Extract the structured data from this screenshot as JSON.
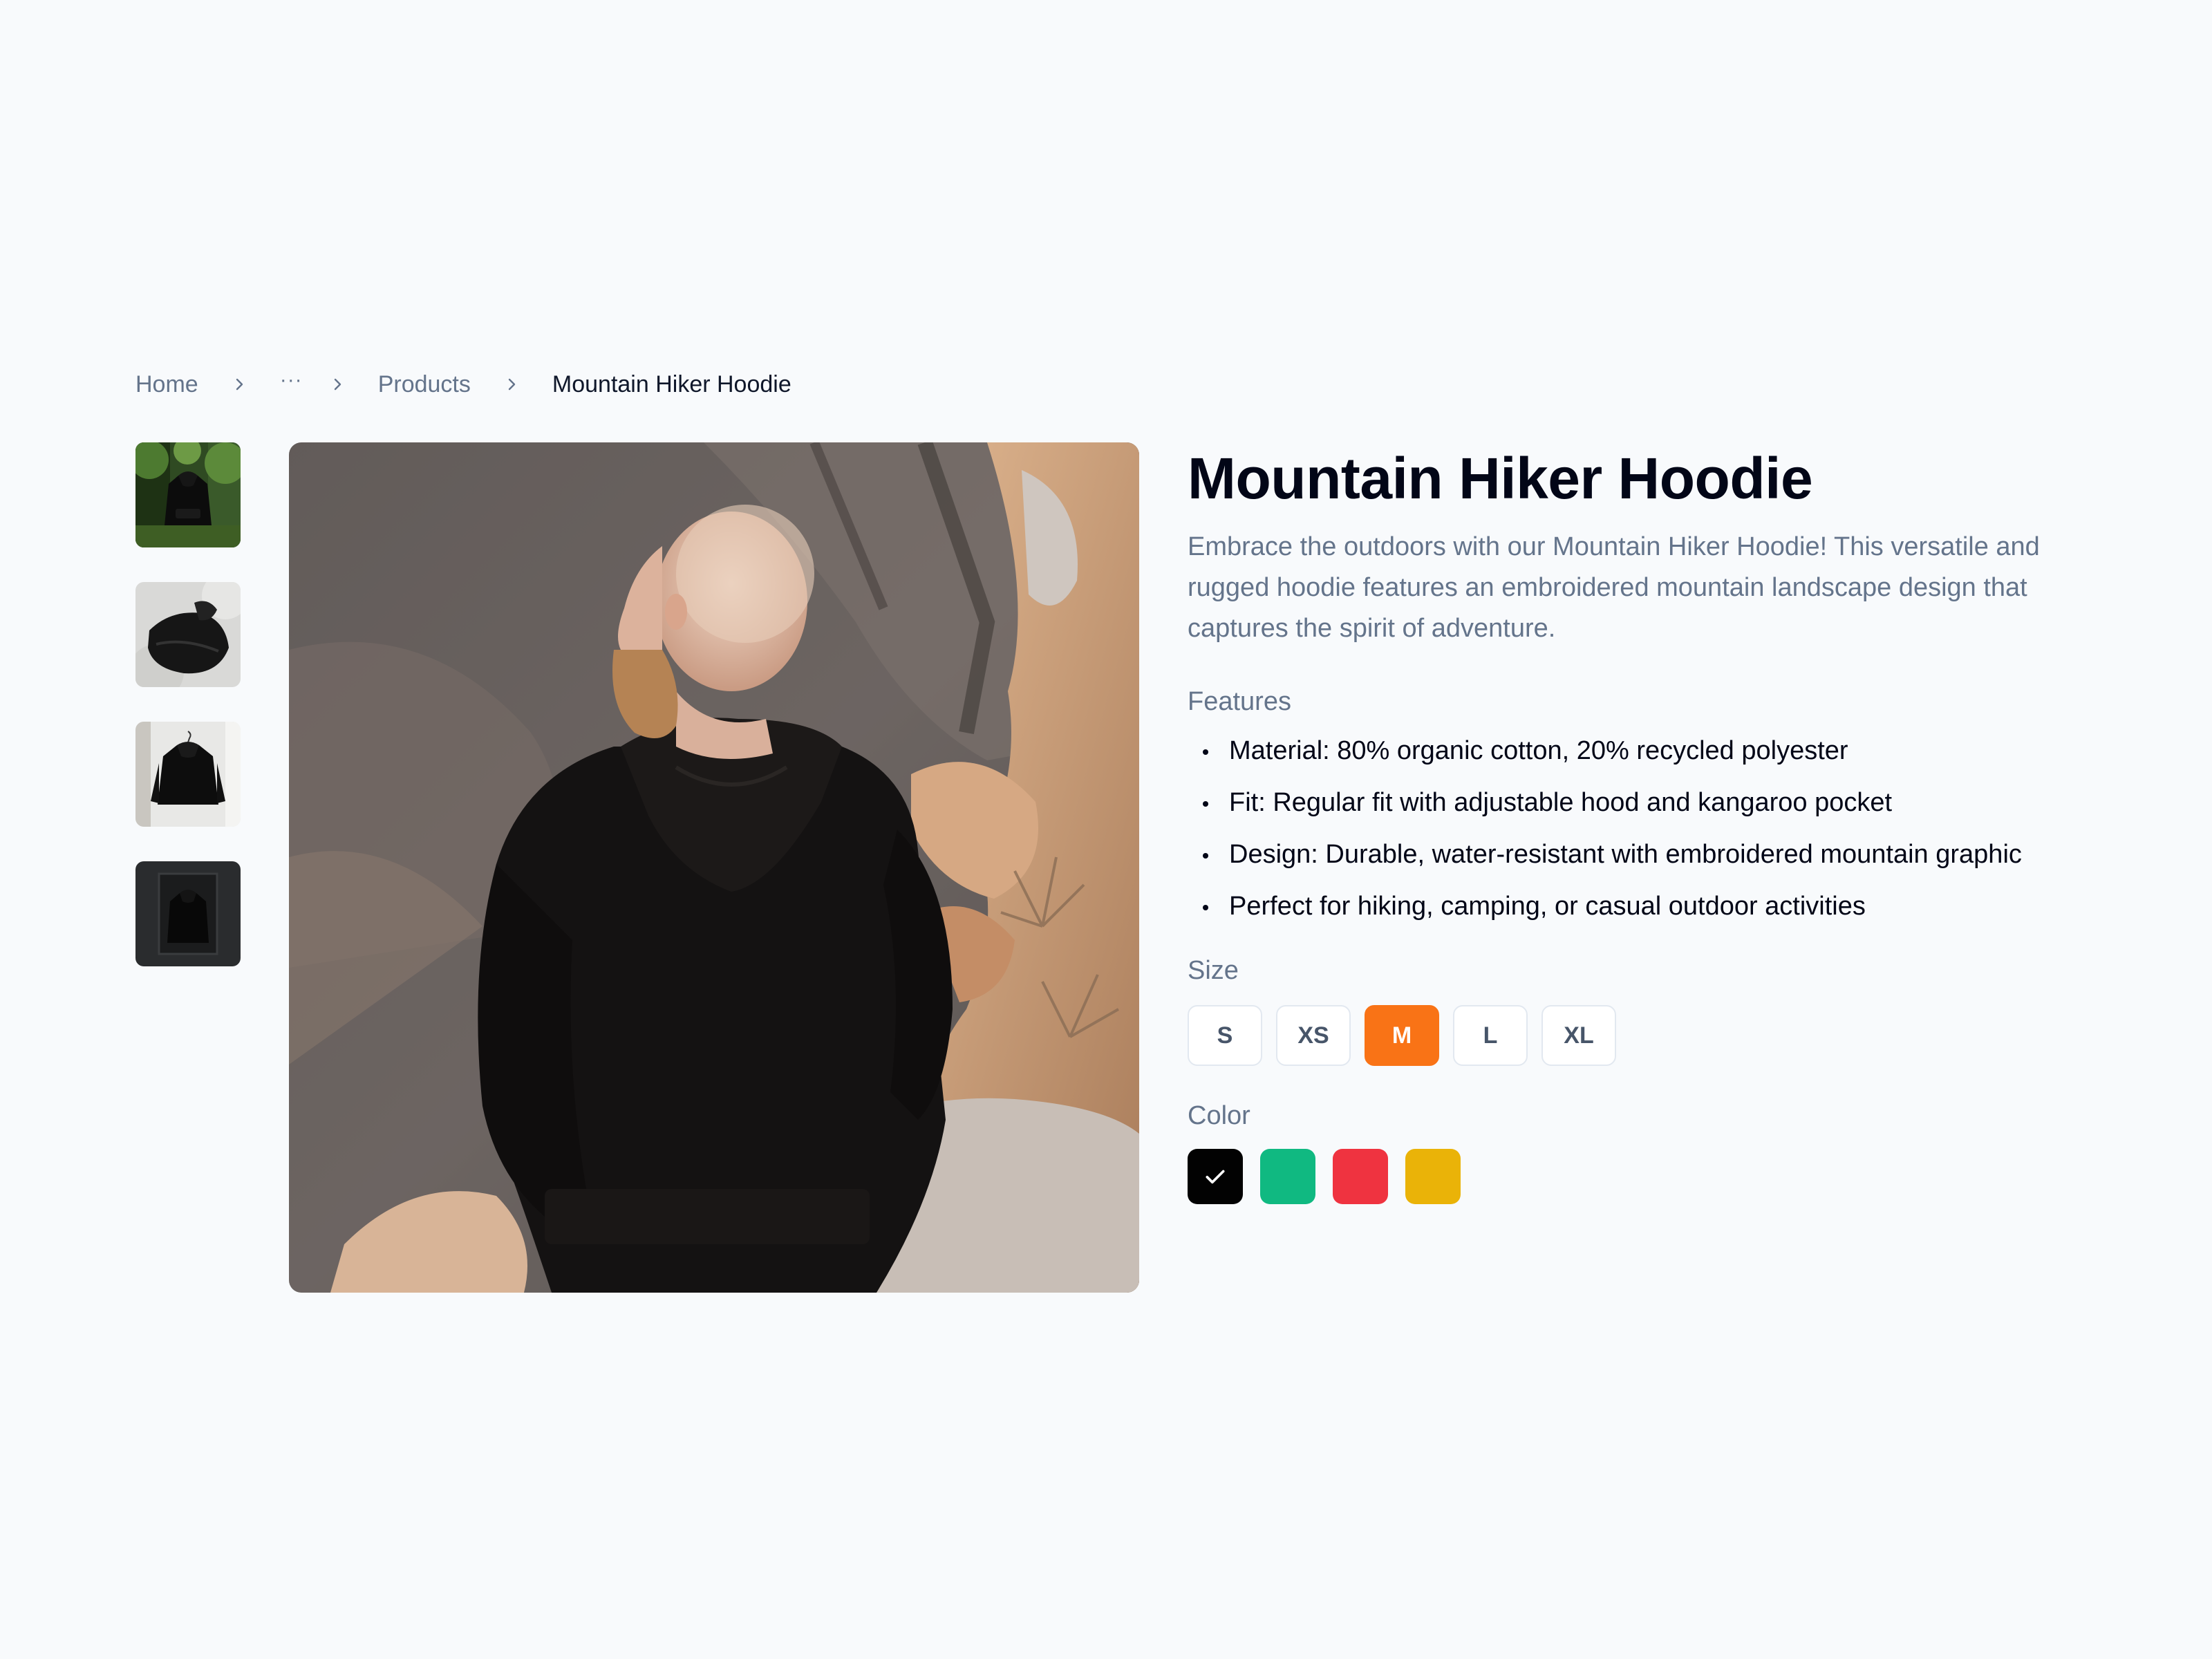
{
  "breadcrumb": {
    "home": "Home",
    "ellipsis": "···",
    "products": "Products",
    "current": "Mountain Hiker Hoodie"
  },
  "product": {
    "title": "Mountain Hiker Hoodie",
    "description": "Embrace the outdoors with our Mountain Hiker Hoodie! This versatile and rugged hoodie features an embroidered mountain landscape design that captures the spirit of adventure."
  },
  "features": {
    "label": "Features",
    "items": [
      "Material: 80% organic cotton, 20% recycled polyester",
      "Fit: Regular fit with adjustable hood and kangaroo pocket",
      "Design: Durable, water-resistant with embroidered mountain graphic",
      "Perfect for hiking, camping, or casual outdoor activities"
    ]
  },
  "size": {
    "label": "Size",
    "options": [
      "S",
      "XS",
      "M",
      "L",
      "XL"
    ],
    "selected": "M"
  },
  "color": {
    "label": "Color",
    "options": [
      {
        "name": "black",
        "hex": "#020202"
      },
      {
        "name": "green",
        "hex": "#10b981"
      },
      {
        "name": "red",
        "hex": "#ef3340"
      },
      {
        "name": "yellow",
        "hex": "#eab308"
      }
    ],
    "selected": "black"
  },
  "theme": {
    "accent": "#f97316",
    "muted_text": "#64748b",
    "background": "#f8fafc"
  },
  "icons": {
    "breadcrumb_separator": "chevron-right-icon",
    "color_selected": "check-icon"
  }
}
